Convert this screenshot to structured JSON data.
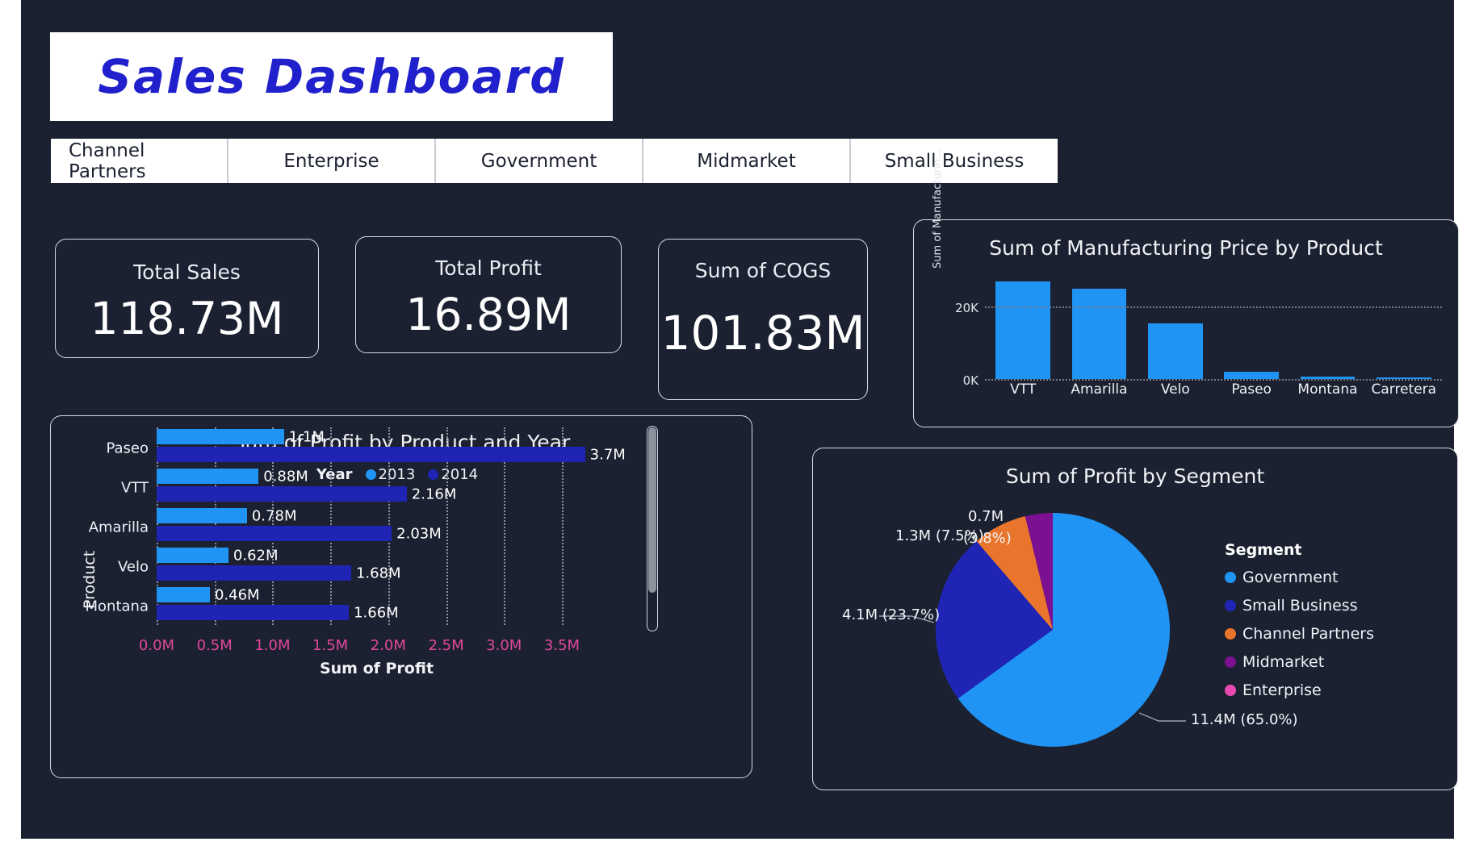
{
  "header": {
    "title": "Sales Dashboard",
    "title_color": "#2020cc"
  },
  "segment_tabs": [
    {
      "label": "Channel Partners"
    },
    {
      "label": "Enterprise"
    },
    {
      "label": "Government"
    },
    {
      "label": "Midmarket"
    },
    {
      "label": "Small Business"
    }
  ],
  "kpis": [
    {
      "title": "Total Sales",
      "value": "118.73M"
    },
    {
      "title": "Total Profit",
      "value": "16.89M"
    },
    {
      "title": "Sum of COGS",
      "value": "101.83M"
    }
  ],
  "chart_data": [
    {
      "type": "bar",
      "title": "Sum of Manufacturing Price by Product",
      "xlabel": "",
      "ylabel": "Sum of Manufacturin...",
      "categories": [
        "VTT",
        "Amarilla",
        "Velo",
        "Paseo",
        "Montana",
        "Carretera"
      ],
      "values": [
        27000,
        25000,
        15300,
        2000,
        600,
        400
      ],
      "ylim": [
        0,
        30000
      ],
      "yticks": [
        0,
        20000
      ],
      "ytick_labels": [
        "0K",
        "20K"
      ],
      "grid": true,
      "series_color": "#1f94f5",
      "legend": "none"
    },
    {
      "type": "bar",
      "orientation": "horizontal",
      "title": "Sum of Profit by Product and Year",
      "xlabel": "Sum of Profit",
      "ylabel": "Product",
      "legend_title": "Year",
      "legend_position": "top",
      "categories": [
        "Paseo",
        "VTT",
        "Amarilla",
        "Velo",
        "Montana"
      ],
      "series": [
        {
          "name": "2013",
          "color": "#1f94f5",
          "values": [
            1.1,
            0.88,
            0.78,
            0.62,
            0.46
          ],
          "labels": [
            "1.1M",
            "0.88M",
            "0.78M",
            "0.62M",
            "0.46M"
          ]
        },
        {
          "name": "2014",
          "color": "#1f24b5",
          "values": [
            3.7,
            2.16,
            2.03,
            1.68,
            1.66
          ],
          "labels": [
            "3.7M",
            "2.16M",
            "2.03M",
            "1.68M",
            "1.66M"
          ]
        }
      ],
      "xlim": [
        0,
        3.8
      ],
      "xtick_labels": [
        "0.0M",
        "0.5M",
        "1.0M",
        "1.5M",
        "2.0M",
        "2.5M",
        "3.0M",
        "3.5M"
      ],
      "xtick_values": [
        0,
        0.5,
        1.0,
        1.5,
        2.0,
        2.5,
        3.0,
        3.5
      ],
      "xtick_color": "#e0489b",
      "grid": true,
      "has_scrollbar": true
    },
    {
      "type": "pie",
      "title": "Sum of Profit by Segment",
      "legend_title": "Segment",
      "legend_position": "right",
      "slices": [
        {
          "label": "Government",
          "value": 11.4,
          "percent": 65.0,
          "color": "#1f94f5",
          "data_label": "11.4M (65.0%)"
        },
        {
          "label": "Small Business",
          "value": 4.1,
          "percent": 23.7,
          "color": "#1f24b5",
          "data_label": "4.1M (23.7%)"
        },
        {
          "label": "Channel Partners",
          "value": 1.3,
          "percent": 7.5,
          "color": "#e8752b",
          "data_label": "1.3M (7.5%)"
        },
        {
          "label": "Midmarket",
          "value": 0.7,
          "percent": 3.8,
          "color": "#7b1090",
          "data_label": "0.7M\n(3.8%)"
        },
        {
          "label": "Enterprise",
          "value": 0.0,
          "percent": 0.0,
          "color": "#e849b0",
          "data_label": ""
        }
      ],
      "pie_labels": {
        "midmarket_line1": "0.7M",
        "midmarket_line2": "(3.8%)",
        "channel": "1.3M (7.5%)",
        "small_business": "4.1M (23.7%)",
        "government": "11.4M (65.0%)"
      }
    }
  ],
  "theme": {
    "page_background": "#1b2130",
    "card_border": "#d8dbe2",
    "text_primary": "#ffffff"
  }
}
